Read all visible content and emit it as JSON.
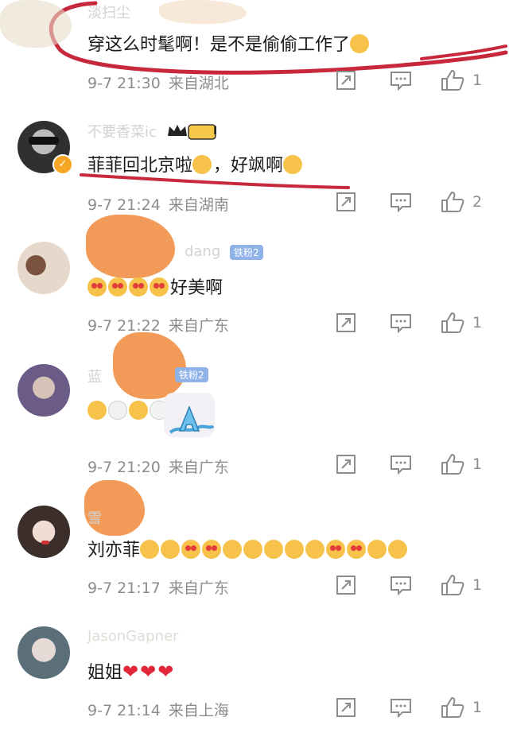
{
  "comments": [
    {
      "name": "淡扫尘",
      "text": "穿这么时髦啊！是不是偷偷工作了",
      "time": "9-7 21:30",
      "location": "来自湖北",
      "likes": "1"
    },
    {
      "name": "不要香菜ic",
      "badge": "I",
      "text": "菲菲回北京啦",
      "text_tail": "，好飒啊",
      "time": "9-7 21:24",
      "location": "来自湖南",
      "likes": "2"
    },
    {
      "name": "dang",
      "badge": "铁粉2",
      "text": "好美啊",
      "time": "9-7 21:22",
      "location": "来自广东",
      "likes": "1"
    },
    {
      "name": "蓝",
      "badge": "铁粉2",
      "text": "",
      "time": "9-7 21:20",
      "location": "来自广东",
      "likes": "1"
    },
    {
      "name": "雪",
      "text": "刘亦菲",
      "time": "9-7 21:17",
      "location": "来自广东",
      "likes": "1"
    },
    {
      "name": "JasonGapner",
      "text": "姐姐",
      "time": "9-7 21:14",
      "location": "来自上海",
      "likes": "1"
    }
  ],
  "colors": {
    "text": "#1a1a1a",
    "meta": "#8c8c8c",
    "annotation": "#c8283c",
    "scribble": "#f08a3c"
  },
  "icons": [
    "share-icon",
    "comment-icon",
    "like-icon"
  ]
}
